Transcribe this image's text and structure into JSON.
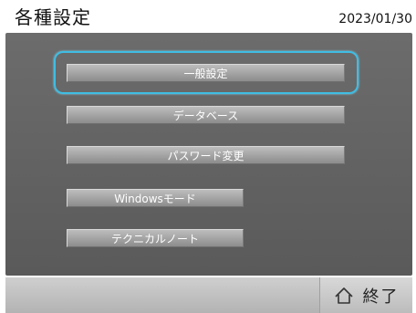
{
  "header": {
    "title": "各種設定",
    "date": "2023/01/30"
  },
  "menu": {
    "items": [
      {
        "label": "一般設定"
      },
      {
        "label": "データベース"
      },
      {
        "label": "パスワード変更"
      },
      {
        "label": "Windowsモード"
      },
      {
        "label": "テクニカルノート"
      }
    ]
  },
  "footer": {
    "exit_label": "終了",
    "exit_icon": "home-icon"
  },
  "colors": {
    "panel": "#5f5f5f",
    "button": "#a6a6a6",
    "focus": "#40bde3",
    "footer": "#c4c4c4"
  }
}
